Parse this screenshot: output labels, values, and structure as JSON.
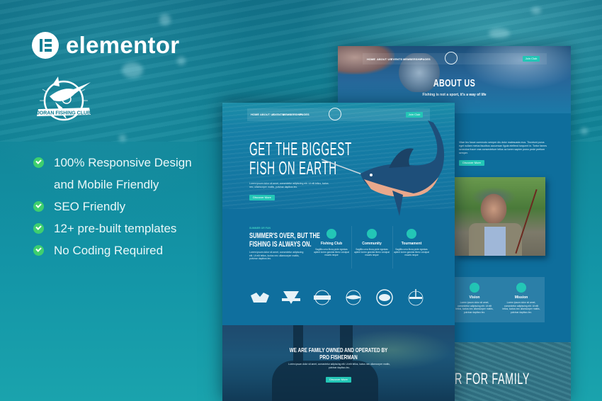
{
  "brand": {
    "name": "elementor",
    "club_logo_text": "JORAN FISHING CLUB"
  },
  "features": [
    "100% Responsive Design and Mobile Friendly",
    "SEO Friendly",
    "12+ pre-built templates",
    "No Coding Required"
  ],
  "features_display": {
    "line1a": "100% Responsive Design",
    "line1b": "and Mobile Friendly"
  },
  "colors": {
    "accent": "#23c6b6",
    "check": "#3ecf6e",
    "mockup_blue": "#0f6f9e"
  },
  "mockup_back": {
    "nav": [
      "HOME",
      "ABOUT US",
      "EVENTS",
      "MEMBERSHIP",
      "PAGES"
    ],
    "nav_button": "Join Club",
    "title": "ABOUT US",
    "subtitle": "Fishing is not a sport, it's a way of life",
    "hero_button": "Join Club",
    "body_text": "Vitae leo fusce commodo semper dis dolor malesuada mus. Tincidunt purus eget nullam metus faucibus accumsan ligula eleifend torquent in. Tortor fames senectus fusce cras consectetuer tellus ac lorem sapien purus pede pretium semper.",
    "body_button": "Discover More",
    "cards": [
      {
        "title": "Vision",
        "text": "Lorem ipsum dolor sit amet, consectetur adipiscing elit. Ut elit tellus, luctus nec ullamcorper mattis, pulvinar dapibus leo."
      },
      {
        "title": "Mission",
        "text": "Lorem ipsum dolor sit amet, consectetur adipiscing elit. Ut elit tellus, luctus nec ullamcorper mattis, pulvinar dapibus leo."
      }
    ],
    "bottom_title": "R FOR FAMILY"
  },
  "mockup_front": {
    "nav": [
      "HOME",
      "ABOUT US",
      "EVENTS",
      "MEMBERSHIP",
      "PAGES"
    ],
    "nav_button": "Join Club",
    "hero_title_line1": "GET THE BIGGEST",
    "hero_title_line2": "FISH ON EARTH",
    "hero_text": "Lorem ipsum dolor sit amet, consectetur adipiscing elit. Ut elit tellus, luctus nec, ullamcorper mattis, pulvinar dapibus leo.",
    "hero_button": "Discover More",
    "summer_kicker": "SUMMER OR FUN",
    "summer_title_line1": "SUMMER'S OVER, BUT THE",
    "summer_title_line2": "FISHING IS ALWAYS ON.",
    "summer_text": "Lorem ipsum dolor sit amet, consectetur adipiscing elit. Ut elit tellus, luctus nec ullamcorper mattis, pulvinar dapibus leo.",
    "features": [
      {
        "title": "Fishing Club",
        "text": "Sagittis urna litora pede egestas aptent lorem gravida libero volutpat mauris neque"
      },
      {
        "title": "Community",
        "text": "Sagittis urna litora pede egestas aptent lorem gravida libero volutpat mauris neque"
      },
      {
        "title": "Tournament",
        "text": "Sagittis urna litora pede egestas aptent lorem gravida libero volutpat mauris neque"
      }
    ],
    "bottom_title_line1": "WE ARE FAMILY OWNED AND OPERATED BY",
    "bottom_title_line2": "PRO FISHERMAN",
    "bottom_text": "Lorem ipsum dolor sit amet, consectetur adipiscing elit. Ut elit tellus, luctus nec ullamcorper mattis, pulvinar dapibus leo.",
    "bottom_button": "Discover More"
  }
}
